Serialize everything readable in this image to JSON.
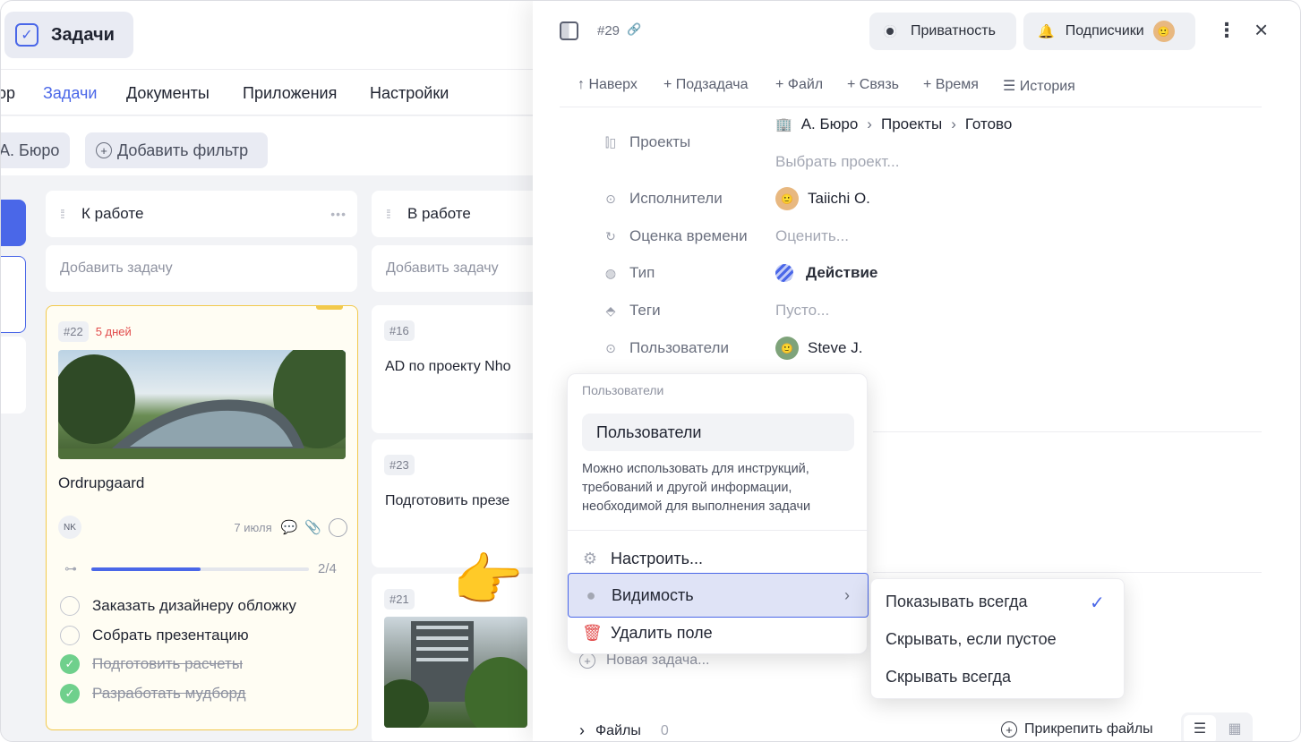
{
  "app": {
    "title": "Задачи"
  },
  "nav": {
    "items": [
      "ор",
      "Задачи",
      "Документы",
      "Приложения",
      "Настройки"
    ],
    "active_index": 1
  },
  "filters": {
    "chip": "А. Бюро",
    "add_filter": "Добавить фильтр"
  },
  "board": {
    "columns": [
      {
        "title": "К работе",
        "add": "Добавить задачу"
      },
      {
        "title": "В работе",
        "add": "Добавить задачу"
      }
    ],
    "card22": {
      "id": "#22",
      "due": "5 дней",
      "title": "Ordrupgaard",
      "assignee": "NK",
      "date": "7 июля",
      "progress": "2/4",
      "progress_fraction": 0.5,
      "checklist": [
        {
          "text": "Заказать дизайнеру обложку",
          "done": false
        },
        {
          "text": "Собрать презентацию",
          "done": false
        },
        {
          "text": "Подготовить расчеты",
          "done": true
        },
        {
          "text": "Разработать мудборд",
          "done": true
        }
      ]
    },
    "card16": {
      "id": "#16",
      "title": "AD по проекту Nho"
    },
    "card23": {
      "id": "#23",
      "title": "Подготовить презе"
    },
    "card21": {
      "id": "#21"
    }
  },
  "panel": {
    "task_id": "#29",
    "privacy": "Приватность",
    "subscribers": "Подписчики",
    "actions": [
      "↑ Наверх",
      "+ Подзадача",
      "+ Файл",
      "+ Связь",
      "+ Время",
      "☰ История"
    ],
    "fields": {
      "projects_label": "Проекты",
      "breadcrumb": [
        "А. Бюро",
        "Проекты",
        "Готово"
      ],
      "choose_project": "Выбрать проект...",
      "assignees_label": "Исполнители",
      "assignee": "Taiichi O.",
      "estimate_label": "Оценка времени",
      "estimate_value": "Оценить...",
      "type_label": "Тип",
      "type_value": "Действие",
      "tags_label": "Теги",
      "tags_value": "Пусто...",
      "users_label": "Пользователи",
      "users_value": "Steve J."
    },
    "new_task": "Новая задача...",
    "files_label": "Файлы",
    "files_count": "0",
    "attach": "Прикрепить файлы"
  },
  "popup": {
    "title": "Пользователи",
    "input_value": "Пользователи",
    "description": "Можно использовать для инструкций, требований и другой информации, необходимой для выполнения задачи",
    "configure": "Настроить...",
    "visibility": "Видимость",
    "delete": "Удалить поле"
  },
  "visibility_menu": {
    "options": [
      "Показывать всегда",
      "Скрывать, если пустое",
      "Скрывать всегда"
    ],
    "selected_index": 0
  },
  "colors": {
    "accent": "#4a67e8",
    "highlight": "#dfe3f6",
    "card_highlight": "#fffdf3",
    "yellow": "#f2c94c",
    "danger": "#e24c4c",
    "done": "#6fd08c"
  }
}
